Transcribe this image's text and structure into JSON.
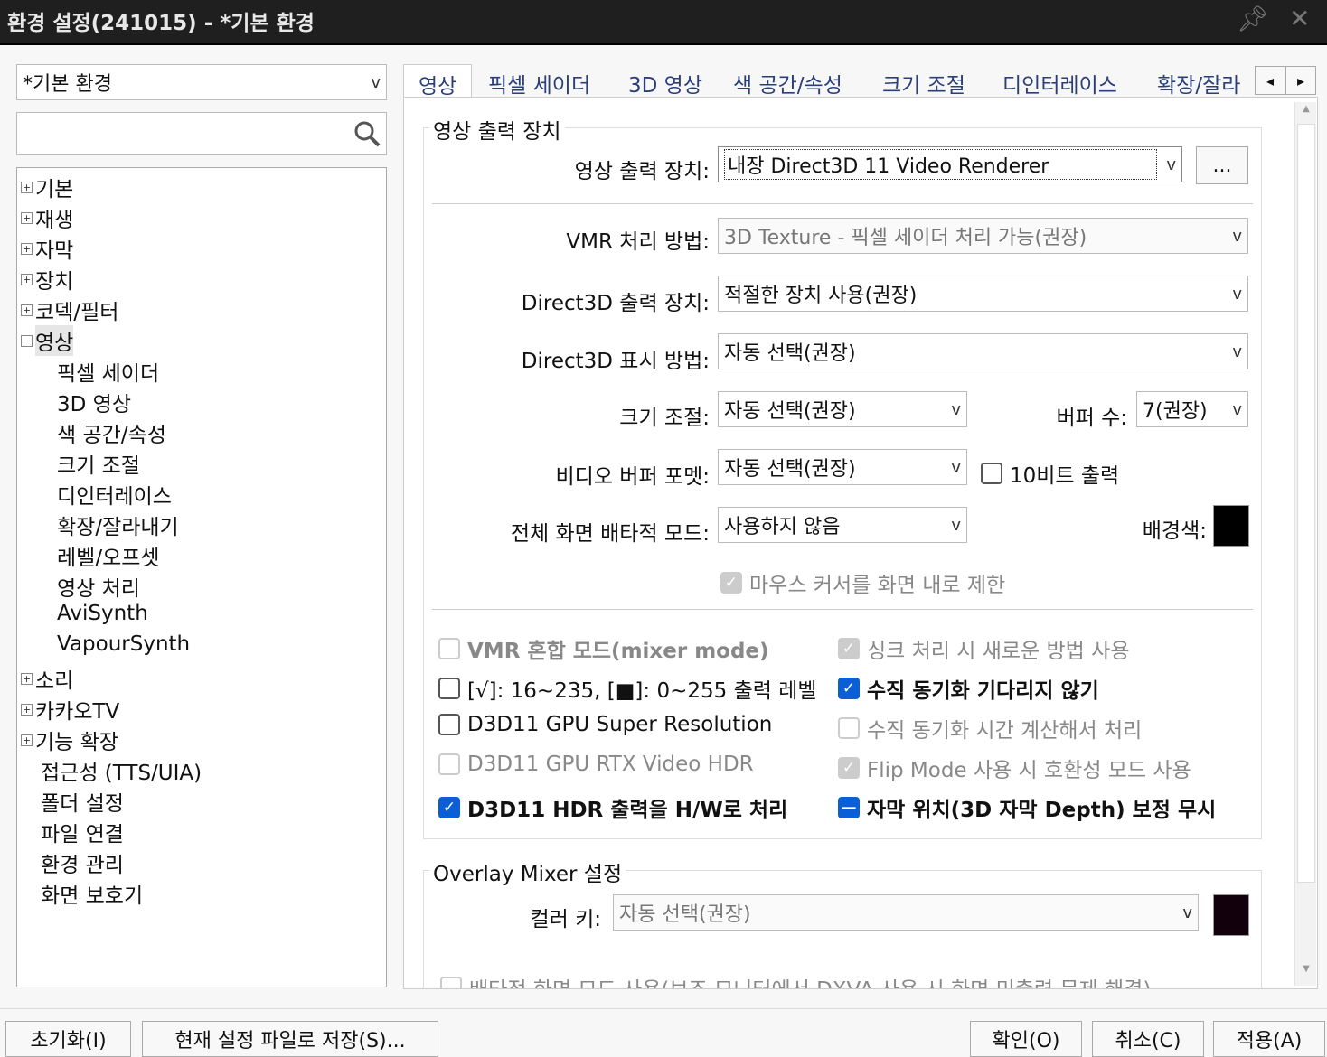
{
  "window": {
    "title": "환경 설정(241015) - *기본 환경",
    "pin_icon": "pin-icon",
    "close_icon": "close-icon"
  },
  "profile": {
    "value": "*기본 환경",
    "arrow": "v"
  },
  "search": {
    "value": "",
    "placeholder": ""
  },
  "tree": [
    {
      "label": "기본",
      "exp": "+"
    },
    {
      "label": "재생",
      "exp": "+"
    },
    {
      "label": "자막",
      "exp": "+"
    },
    {
      "label": "장치",
      "exp": "+"
    },
    {
      "label": "코덱/필터",
      "exp": "+"
    },
    {
      "label": "영상",
      "exp": "−"
    },
    {
      "label": "픽셀 세이더",
      "child": true
    },
    {
      "label": "3D 영상",
      "child": true
    },
    {
      "label": "색 공간/속성",
      "child": true
    },
    {
      "label": "크기 조절",
      "child": true
    },
    {
      "label": "디인터레이스",
      "child": true
    },
    {
      "label": "확장/잘라내기",
      "child": true
    },
    {
      "label": "레벨/오프셋",
      "child": true
    },
    {
      "label": "영상 처리",
      "child": true
    },
    {
      "label": "AviSynth",
      "child": true
    },
    {
      "label": "VapourSynth",
      "child": true
    },
    {
      "label": "소리",
      "exp": "+"
    },
    {
      "label": "카카오TV",
      "exp": "+"
    },
    {
      "label": "기능 확장",
      "exp": "+"
    },
    {
      "label": "접근성 (TTS/UIA)"
    },
    {
      "label": "폴더 설정"
    },
    {
      "label": "파일 연결"
    },
    {
      "label": "환경 관리"
    },
    {
      "label": "화면 보호기"
    }
  ],
  "tabs": [
    "영상",
    "픽셀 세이더",
    "3D 영상",
    "색 공간/속성",
    "크기 조절",
    "디인터레이스",
    "확장/잘라"
  ],
  "tab_nav": {
    "prev": "◂",
    "next": "▸"
  },
  "group1": {
    "title": "영상 출력 장치",
    "device_label": "영상 출력 장치:",
    "device_value": "내장 Direct3D 11 Video Renderer",
    "device_more": "...",
    "vmr_label": "VMR 처리 방법:",
    "vmr_value": "3D Texture - 픽셀 세이더 처리 가능(권장)",
    "d3d_dev_label": "Direct3D 출력 장치:",
    "d3d_dev_value": "적절한 장치 사용(권장)",
    "d3d_disp_label": "Direct3D 표시 방법:",
    "d3d_disp_value": "자동 선택(권장)",
    "scale_label": "크기 조절:",
    "scale_value": "자동 선택(권장)",
    "buffer_label": "버퍼 수:",
    "buffer_value": "7(권장)",
    "fmt_label": "비디오 버퍼 포멧:",
    "fmt_value": "자동 선택(권장)",
    "tenbit": "10비트 출력",
    "fs_label": "전체 화면 배타적 모드:",
    "fs_value": "사용하지 않음",
    "bg_label": "배경색:",
    "bg_color": "#000000",
    "mouse": "마우스 커서를 화면 내로 제한",
    "checks_left": [
      "VMR 혼합 모드(mixer mode)",
      "[√]: 16~235, [■]: 0~255 출력 레벨",
      "D3D11 GPU Super Resolution",
      "D3D11 GPU RTX Video HDR",
      "D3D11 HDR 출력을 H/W로 처리"
    ],
    "checks_right": [
      "싱크 처리 시 새로운 방법 사용",
      "수직 동기화 기다리지 않기",
      "수직 동기화 시간 계산해서 처리",
      "Flip Mode 사용 시 호환성 모드 사용",
      "자막 위치(3D 자막 Depth) 보정 무시"
    ]
  },
  "group2": {
    "title": "Overlay Mixer 설정",
    "key_label": "컬러 키:",
    "key_value": "자동 선택(권장)",
    "key_color": "#12000c",
    "exclusive": "배타적 화면 모드 사용(보조 모니터에서 DXVA 사용 시 화면 미출력 문제 해결)"
  },
  "buttons": {
    "reset": "초기화(I)",
    "save": "현재 설정 파일로 저장(S)...",
    "ok": "확인(O)",
    "cancel": "취소(C)",
    "apply": "적용(A)"
  },
  "arrow": "v",
  "accent": "#0a5fd6"
}
